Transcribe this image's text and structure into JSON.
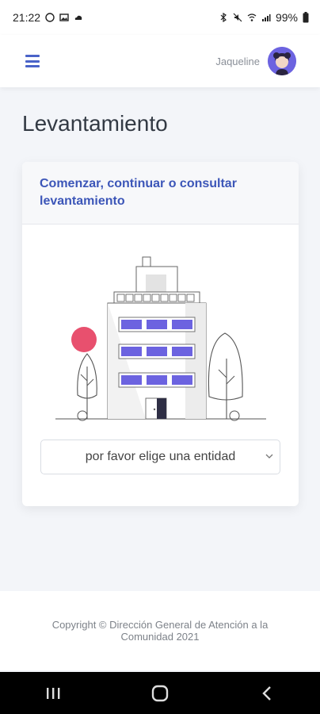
{
  "status_bar": {
    "time": "21:22",
    "battery": "99%"
  },
  "topbar": {
    "menu_icon": "hamburger-menu-icon",
    "user_name": "Jaqueline",
    "avatar_icon": "user-avatar"
  },
  "page": {
    "title": "Levantamiento"
  },
  "card": {
    "header": "Comenzar, continuar o consultar levantamiento",
    "illustration": "building-illustration",
    "select": {
      "placeholder": "por favor elige una entidad"
    }
  },
  "footer": {
    "text": "Copyright © Dirección General de Atención a la Comunidad 2021"
  },
  "navbar": {
    "recents_icon": "recents-icon",
    "home_icon": "home-icon",
    "back_icon": "back-icon"
  },
  "colors": {
    "accent": "#3c56b8",
    "window": "#6c63e0",
    "circle": "#e8506e"
  }
}
